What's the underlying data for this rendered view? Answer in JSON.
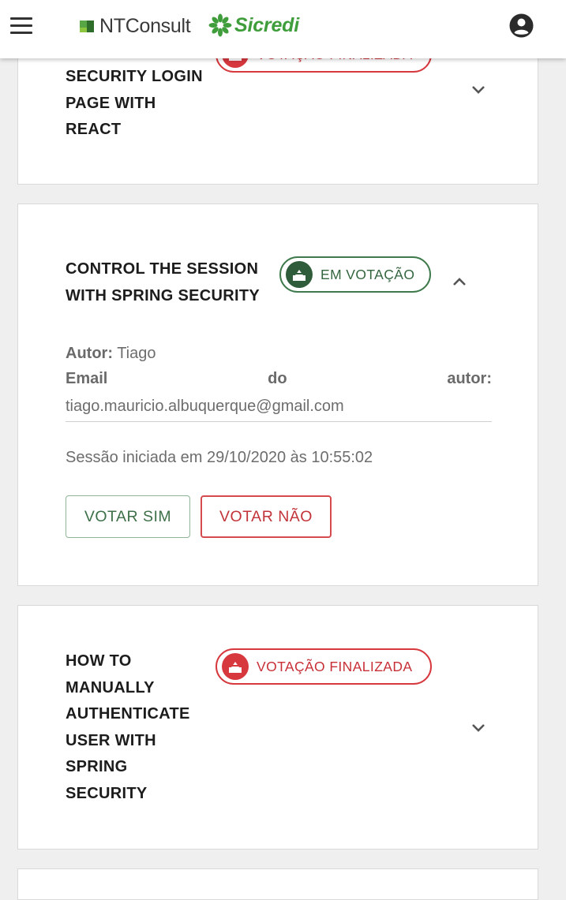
{
  "header": {
    "menu_icon": "hamburger-menu-icon",
    "ntconsult_logo": "NTConsult",
    "sicredi_logo": "Sicredi",
    "account_icon": "account-circle-icon"
  },
  "cards": [
    {
      "title": "SECURITY LOGIN PAGE WITH REACT",
      "title_lines": [
        "SECURITY LOGIN",
        "PAGE WITH",
        "REACT"
      ],
      "status": "VOTAÇÃO FINALIZADA",
      "status_color": "#d6383e",
      "expanded": false,
      "toggle_icon": "chevron-down-icon"
    },
    {
      "title": "CONTROL THE SESSION WITH SPRING SECURITY",
      "title_lines": [
        "CONTROL THE SESSION",
        "WITH SPRING SECURITY"
      ],
      "status": "EM VOTAÇÃO",
      "status_color": "#2f5c3a",
      "expanded": true,
      "toggle_icon": "chevron-up-icon",
      "author_label": "Autor:",
      "author_name": "Tiago",
      "email_label_words": [
        "Email",
        "do",
        "autor:"
      ],
      "email_value": "tiago.mauricio.albuquerque@gmail.com",
      "session_text": "Sessão iniciada em 29/10/2020 às 10:55:02",
      "vote_yes_label": "VOTAR SIM",
      "vote_no_label": "VOTAR NÃO"
    },
    {
      "title": "HOW TO MANUALLY AUTHENTICATE USER WITH SPRING SECURITY",
      "title_lines": [
        "HOW TO",
        "MANUALLY",
        "AUTHENTICATE",
        "USER WITH",
        "SPRING",
        "SECURITY"
      ],
      "status": "VOTAÇÃO FINALIZADA",
      "status_color": "#d6383e",
      "expanded": false,
      "toggle_icon": "chevron-down-icon"
    }
  ],
  "colors": {
    "finalizada": "#d6383e",
    "em_votacao": "#2f5c3a",
    "sicredi_green": "#3f9d3b",
    "ntconsult_green": "#58a646"
  }
}
